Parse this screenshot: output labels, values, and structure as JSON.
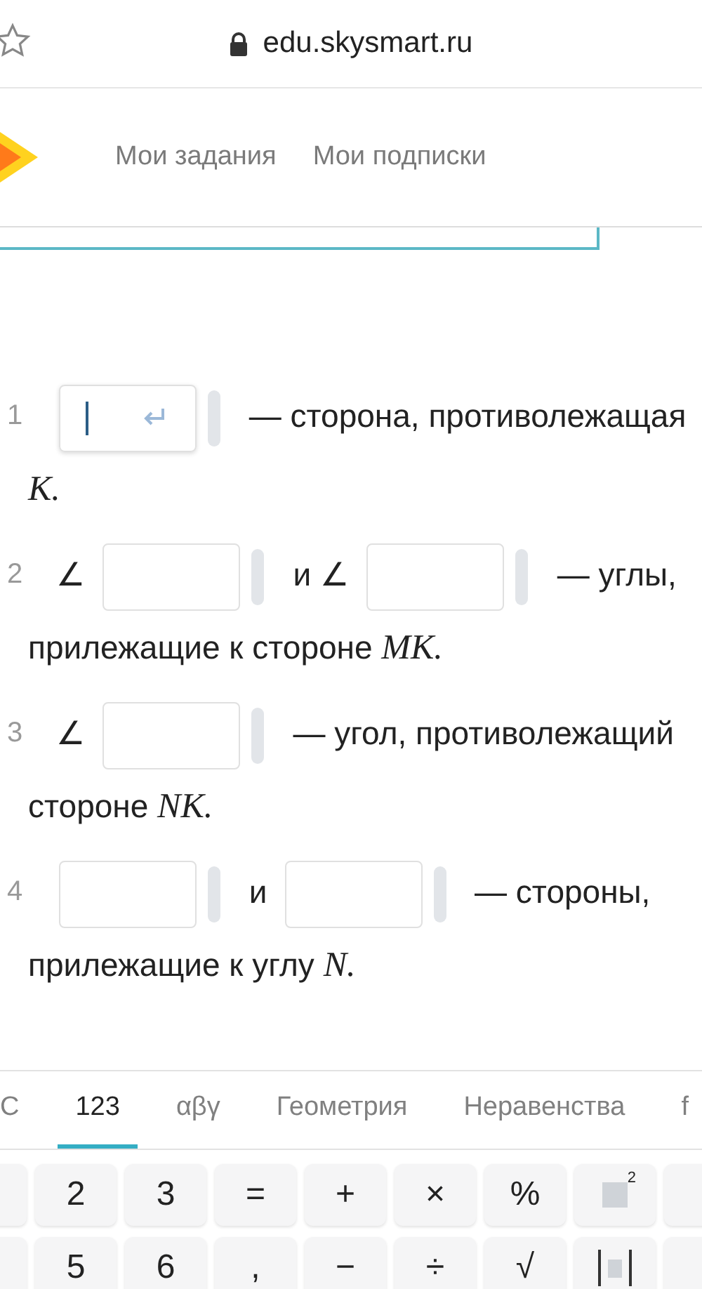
{
  "browser": {
    "url": "edu.skysmart.ru"
  },
  "nav": {
    "links": [
      "Мои задания",
      "Мои подписки"
    ]
  },
  "tasks": [
    {
      "number": "1",
      "parts": [
        {
          "kind": "field",
          "focused": true
        },
        {
          "kind": "text",
          "text": "— сторона, противолежащая"
        },
        {
          "kind": "math",
          "text": "K."
        }
      ]
    },
    {
      "number": "2",
      "parts": [
        {
          "kind": "text",
          "text": "∠"
        },
        {
          "kind": "field",
          "focused": false
        },
        {
          "kind": "text",
          "text": "и ∠"
        },
        {
          "kind": "field",
          "focused": false
        },
        {
          "kind": "text",
          "text": "— углы,"
        },
        {
          "kind": "text",
          "text": "прилежащие к стороне"
        },
        {
          "kind": "math",
          "text": "MK."
        }
      ]
    },
    {
      "number": "3",
      "parts": [
        {
          "kind": "text",
          "text": "∠"
        },
        {
          "kind": "field",
          "focused": false
        },
        {
          "kind": "text",
          "text": "— угол, противолежащий"
        },
        {
          "kind": "text",
          "text": "стороне"
        },
        {
          "kind": "math",
          "text": "NK."
        }
      ]
    },
    {
      "number": "4",
      "parts": [
        {
          "kind": "field",
          "focused": false
        },
        {
          "kind": "text",
          "text": "и"
        },
        {
          "kind": "field",
          "focused": false
        },
        {
          "kind": "text",
          "text": "— стороны,"
        },
        {
          "kind": "text",
          "text": "прилежащие к углу"
        },
        {
          "kind": "math",
          "text": "N."
        }
      ]
    }
  ],
  "keyboard": {
    "tabs": [
      {
        "label": "C",
        "selected": false
      },
      {
        "label": "123",
        "selected": true
      },
      {
        "label": "αβγ",
        "selected": false
      },
      {
        "label": "Геометрия",
        "selected": false
      },
      {
        "label": "Неравенства",
        "selected": false
      },
      {
        "label": "f",
        "selected": false
      }
    ],
    "rows": [
      [
        {
          "kind": "blank"
        },
        {
          "kind": "text",
          "text": "2"
        },
        {
          "kind": "text",
          "text": "3"
        },
        {
          "kind": "text",
          "text": "="
        },
        {
          "kind": "text",
          "text": "+"
        },
        {
          "kind": "text",
          "text": "×"
        },
        {
          "kind": "text",
          "text": "%"
        },
        {
          "kind": "power",
          "text": "2"
        },
        {
          "kind": "blank"
        }
      ],
      [
        {
          "kind": "blank"
        },
        {
          "kind": "text",
          "text": "5"
        },
        {
          "kind": "text",
          "text": "6"
        },
        {
          "kind": "text",
          "text": ","
        },
        {
          "kind": "text",
          "text": "−"
        },
        {
          "kind": "text",
          "text": "÷"
        },
        {
          "kind": "text",
          "text": "√"
        },
        {
          "kind": "abs"
        },
        {
          "kind": "blank"
        }
      ]
    ]
  }
}
